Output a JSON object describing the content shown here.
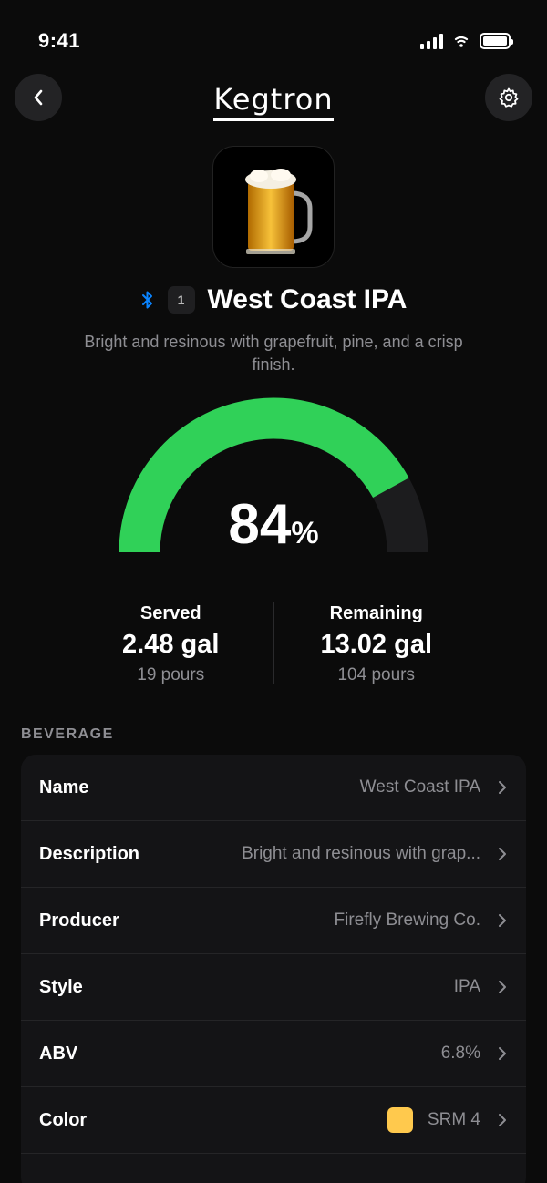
{
  "status_bar": {
    "time": "9:41"
  },
  "app": {
    "logo": "Kegtron"
  },
  "beverage_header": {
    "tap_number": "1",
    "title": "West Coast IPA",
    "description": "Bright and resinous with grapefruit, pine, and a crisp finish."
  },
  "gauge": {
    "percent": 84,
    "percent_text": "84",
    "unit": "%",
    "fill_color": "#30d158",
    "track_color": "#1c1c1e"
  },
  "stats": {
    "served": {
      "label": "Served",
      "value": "2.48 gal",
      "sub": "19 pours"
    },
    "remaining": {
      "label": "Remaining",
      "value": "13.02 gal",
      "sub": "104 pours"
    }
  },
  "section": {
    "title": "BEVERAGE"
  },
  "rows": [
    {
      "label": "Name",
      "value": "West Coast IPA"
    },
    {
      "label": "Description",
      "value": "Bright and resinous with grap..."
    },
    {
      "label": "Producer",
      "value": "Firefly Brewing Co."
    },
    {
      "label": "Style",
      "value": "IPA"
    },
    {
      "label": "ABV",
      "value": "6.8%"
    },
    {
      "label": "Color",
      "value": "SRM 4",
      "swatch": "#ffc94d"
    }
  ],
  "colors": {
    "bluetooth": "#0a84ff",
    "accent_green": "#30d158"
  },
  "icons": [
    "back-chevron-icon",
    "gear-icon",
    "bluetooth-icon",
    "chevron-right-icon",
    "wifi-icon",
    "signal-icon",
    "battery-icon"
  ]
}
